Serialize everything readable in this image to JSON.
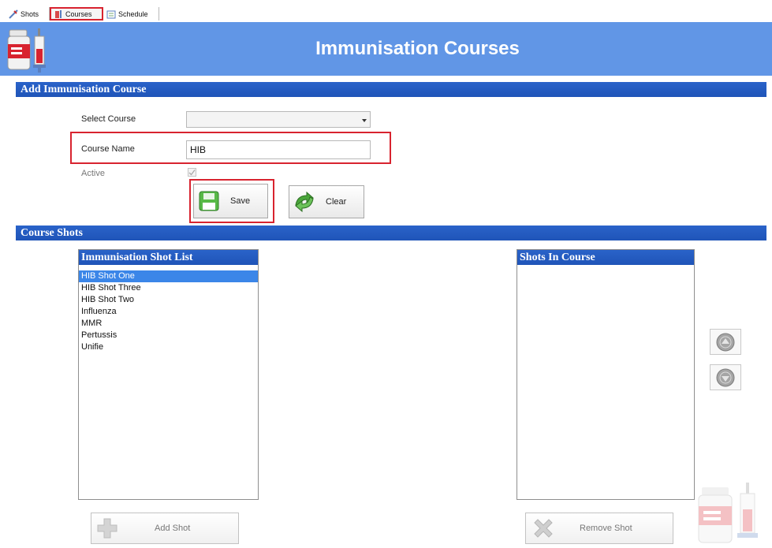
{
  "tabs": [
    {
      "label": "Shots"
    },
    {
      "label": "Courses"
    },
    {
      "label": "Schedule"
    }
  ],
  "header": {
    "title": "Immunisation Courses"
  },
  "add_course": {
    "section_title": "Add Immunisation Course",
    "select_course_label": "Select Course",
    "select_course_value": "",
    "course_name_label": "Course Name",
    "course_name_value": "HIB",
    "active_label": "Active",
    "active_checked": true,
    "save_label": "Save",
    "clear_label": "Clear"
  },
  "course_shots": {
    "section_title": "Course Shots",
    "shot_list_title": "Immunisation Shot List",
    "shot_list": [
      "HIB Shot One",
      "HIB Shot Three",
      "HIB Shot Two",
      "Influenza",
      "MMR",
      "Pertussis",
      "Unifie"
    ],
    "selected_shot": "HIB Shot One",
    "shots_in_course_title": "Shots In Course",
    "shots_in_course": [],
    "add_shot_label": "Add Shot",
    "remove_shot_label": "Remove Shot"
  },
  "colors": {
    "header_bg": "#6196e6",
    "section_bar": "#2a63c9",
    "highlight_red": "#d8232f",
    "selection": "#3b86e8"
  },
  "icons": {
    "app": "vaccine-vial-syringe-icon",
    "save": "floppy-disk-icon",
    "clear": "refresh-arrows-icon",
    "up": "up-arrow-icon",
    "down": "down-arrow-icon",
    "add": "plus-icon",
    "remove": "x-icon"
  }
}
